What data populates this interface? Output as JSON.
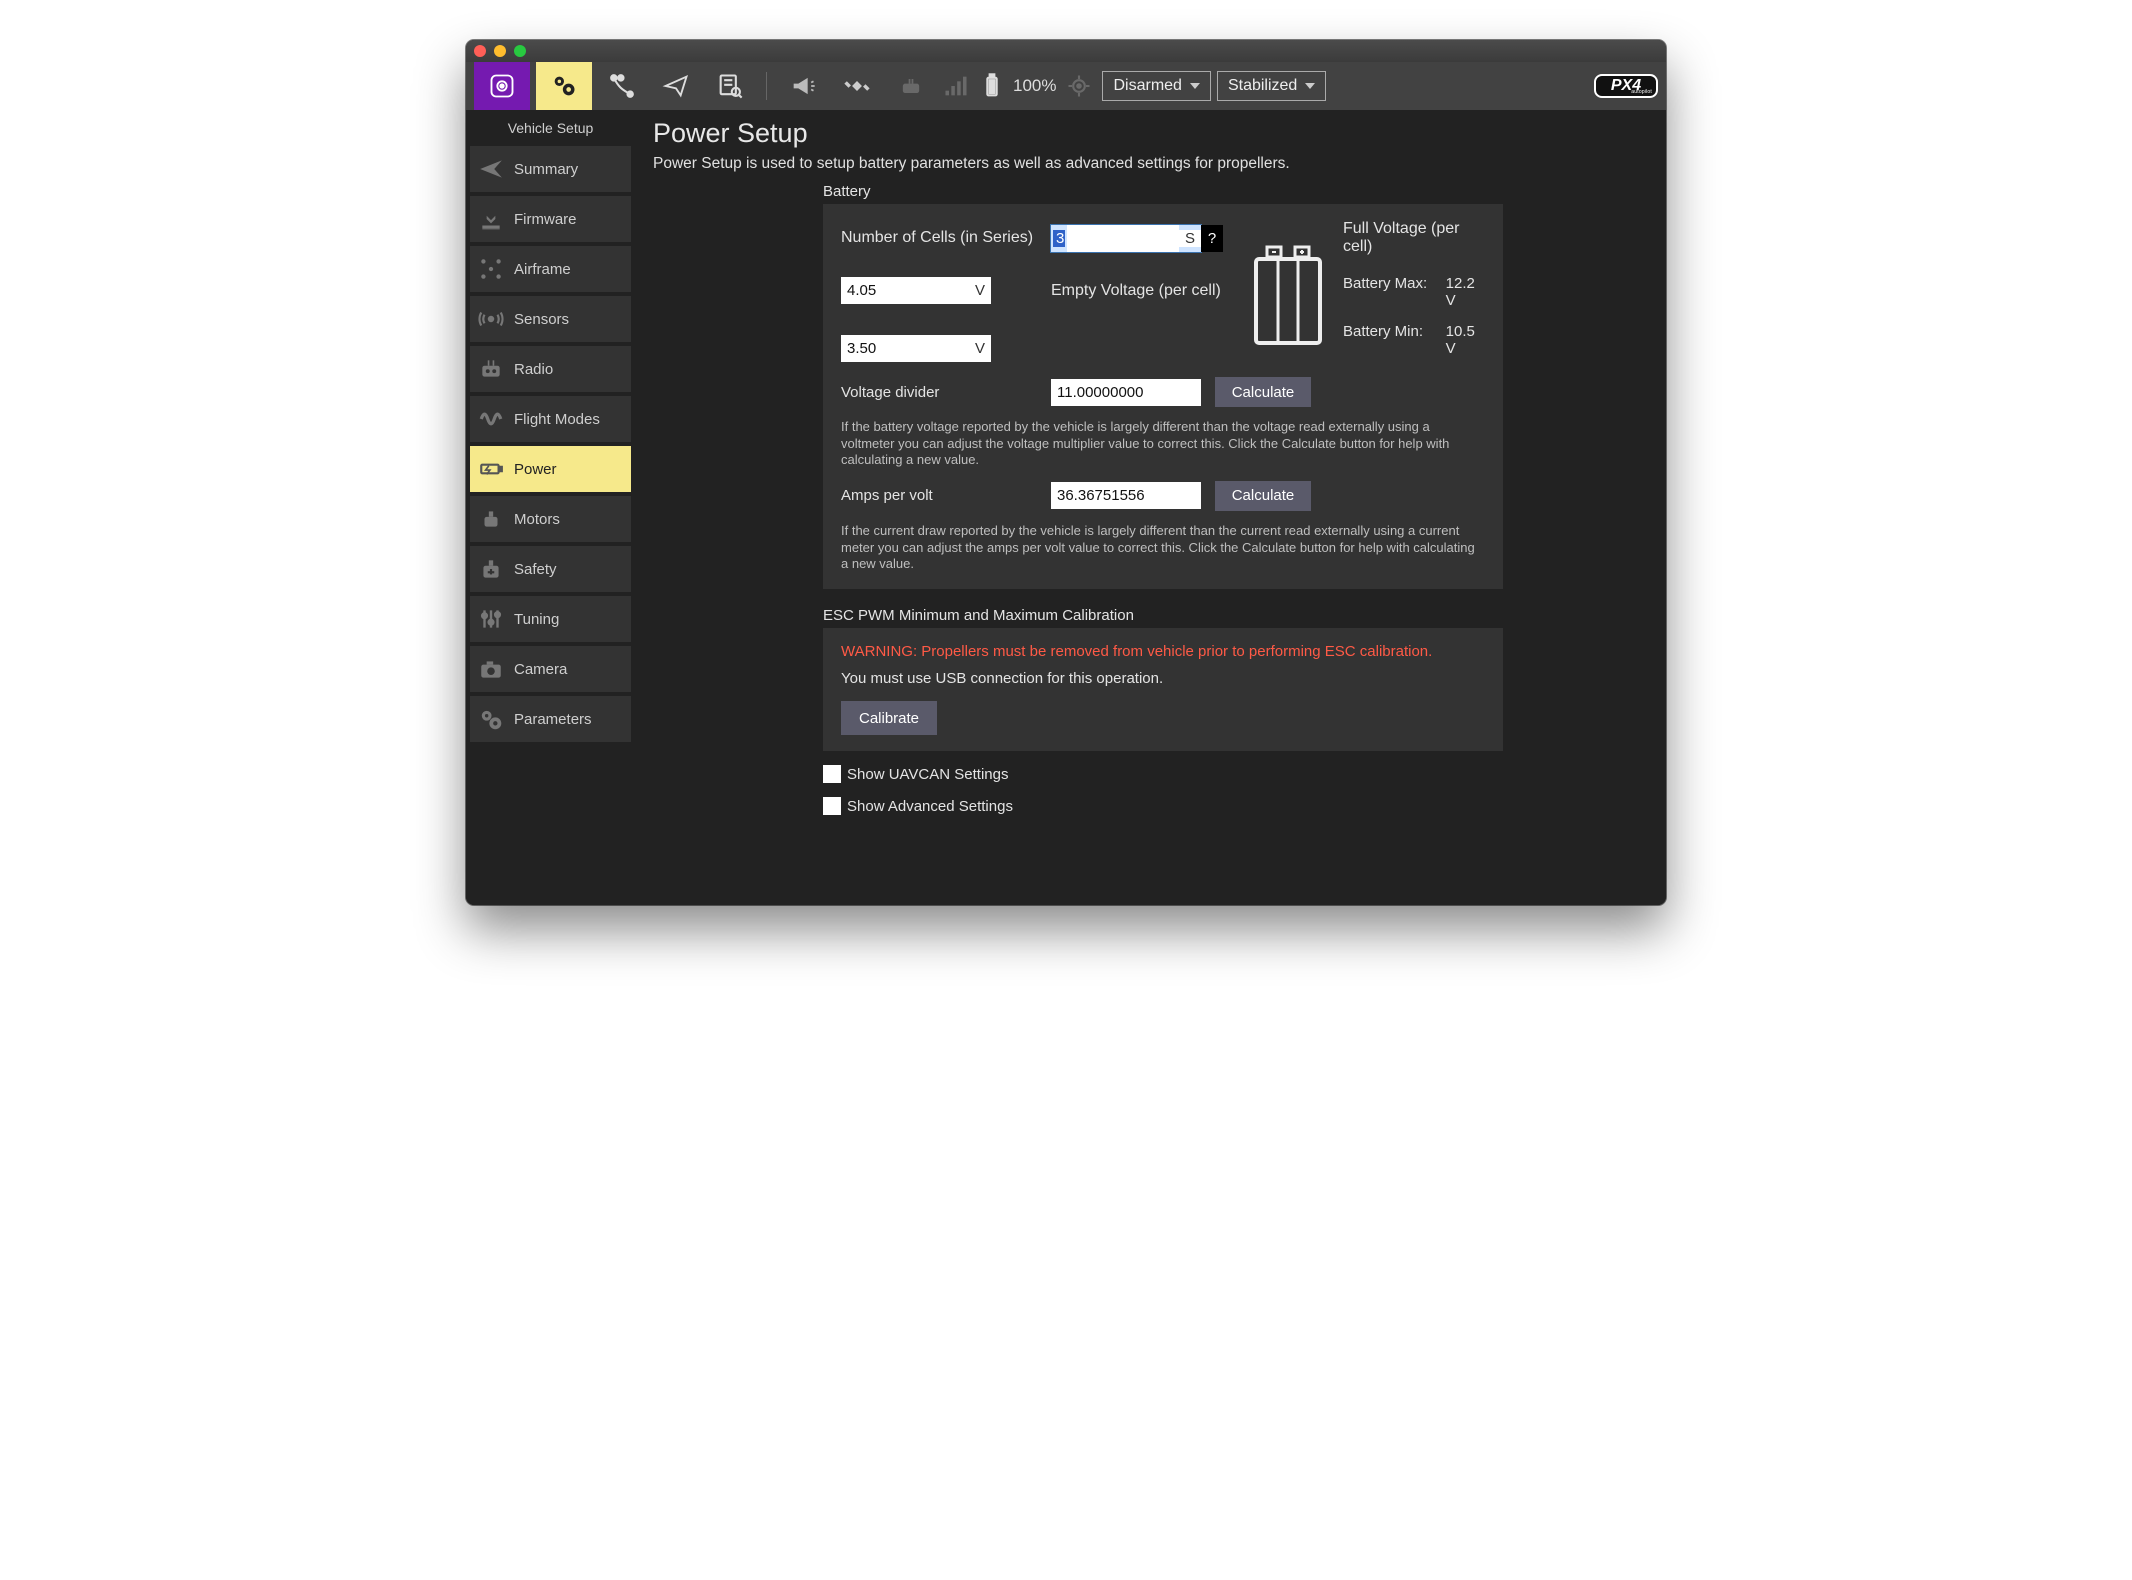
{
  "toolbar": {
    "battery_pct": "100%",
    "armed": "Disarmed",
    "mode": "Stabilized",
    "brand": "PX4"
  },
  "sidebar": {
    "title": "Vehicle Setup",
    "items": [
      {
        "label": "Summary"
      },
      {
        "label": "Firmware"
      },
      {
        "label": "Airframe"
      },
      {
        "label": "Sensors"
      },
      {
        "label": "Radio"
      },
      {
        "label": "Flight Modes"
      },
      {
        "label": "Power"
      },
      {
        "label": "Motors"
      },
      {
        "label": "Safety"
      },
      {
        "label": "Tuning"
      },
      {
        "label": "Camera"
      },
      {
        "label": "Parameters"
      }
    ]
  },
  "page": {
    "title": "Power Setup",
    "subtitle": "Power Setup is used to setup battery parameters as well as advanced settings for propellers."
  },
  "battery": {
    "section": "Battery",
    "cells_label": "Number of Cells (in Series)",
    "cells_value": "3",
    "cells_unit": "S",
    "full_label": "Full Voltage (per cell)",
    "full_value": "4.05",
    "full_unit": "V",
    "empty_label": "Empty Voltage (per cell)",
    "empty_value": "3.50",
    "empty_unit": "V",
    "vdiv_label": "Voltage divider",
    "vdiv_value": "11.00000000",
    "calc_label": "Calculate",
    "vdiv_help": "If the battery voltage reported by the vehicle is largely different than the voltage read externally using a voltmeter you can adjust the voltage multiplier value to correct this. Click the Calculate button for help with calculating a new value.",
    "apv_label": "Amps per volt",
    "apv_value": "36.36751556",
    "apv_help": "If the current draw reported by the vehicle is largely different than the current read externally using a current meter you can adjust the amps per volt value to correct this. Click the Calculate button for help with calculating a new value.",
    "max_label": "Battery Max:",
    "max_value": "12.2 V",
    "min_label": "Battery Min:",
    "min_value": "10.5 V",
    "help_q": "?"
  },
  "esc": {
    "section": "ESC PWM Minimum and Maximum Calibration",
    "warning": "WARNING: Propellers must be removed from vehicle prior to performing ESC calibration.",
    "usb": "You must use USB connection for this operation.",
    "calibrate": "Calibrate"
  },
  "checks": {
    "uavcan": "Show UAVCAN Settings",
    "advanced": "Show Advanced Settings"
  }
}
